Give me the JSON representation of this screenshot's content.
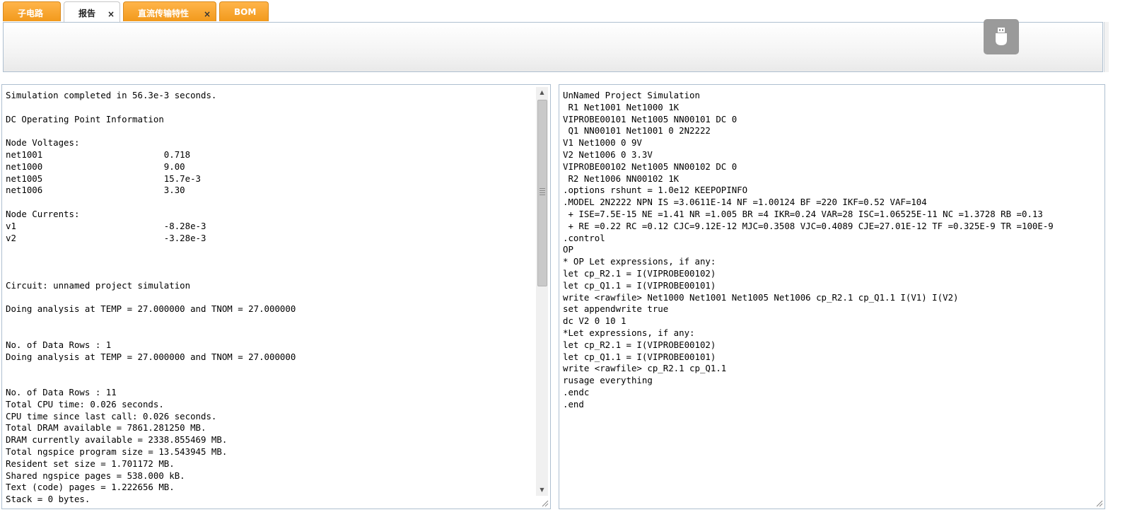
{
  "tabs": [
    {
      "label": "子电路",
      "closable": false,
      "active": false
    },
    {
      "label": "报告",
      "closable": true,
      "active": true
    },
    {
      "label": "直流传输特性",
      "closable": true,
      "active": false
    },
    {
      "label": "BOM",
      "closable": false,
      "active": false
    }
  ],
  "tab_close_glyph": "×",
  "toolbar": {
    "usb_icon": "usb-plug-icon"
  },
  "colors": {
    "tab_orange": "#f29a1c",
    "panel_border": "#aebfd0",
    "usb_button": "#9a9a9a"
  },
  "scrollbar": {
    "up_glyph": "▲",
    "down_glyph": "▼"
  },
  "report": {
    "lines": [
      "Simulation completed in 56.3e-3 seconds.",
      "",
      "DC Operating Point Information",
      "",
      "Node Voltages:",
      "net1001                       0.718",
      "net1000                       9.00",
      "net1005                       15.7e-3",
      "net1006                       3.30",
      "",
      "Node Currents:",
      "v1                            -8.28e-3",
      "v2                            -3.28e-3",
      "",
      "",
      "",
      "Circuit: unnamed project simulation",
      "",
      "Doing analysis at TEMP = 27.000000 and TNOM = 27.000000",
      "",
      "",
      "No. of Data Rows : 1",
      "Doing analysis at TEMP = 27.000000 and TNOM = 27.000000",
      "",
      "",
      "No. of Data Rows : 11",
      "Total CPU time: 0.026 seconds.",
      "CPU time since last call: 0.026 seconds.",
      "Total DRAM available = 7861.281250 MB.",
      "DRAM currently available = 2338.855469 MB.",
      "Total ngspice program size = 13.543945 MB.",
      "Resident set size = 1.701172 MB.",
      "Shared ngspice pages = 538.000 kB.",
      "Text (code) pages = 1.222656 MB.",
      "Stack = 0 bytes."
    ]
  },
  "netlist": {
    "lines": [
      "UnNamed Project Simulation",
      " R1 Net1001 Net1000 1K",
      "VIPROBE00101 Net1005 NN00101 DC 0",
      " Q1 NN00101 Net1001 0 2N2222",
      "V1 Net1000 0 9V",
      "V2 Net1006 0 3.3V",
      "VIPROBE00102 Net1005 NN00102 DC 0",
      " R2 Net1006 NN00102 1K",
      ".options rshunt = 1.0e12 KEEPOPINFO",
      ".MODEL 2N2222 NPN IS =3.0611E-14 NF =1.00124 BF =220 IKF=0.52 VAF=104",
      " + ISE=7.5E-15 NE =1.41 NR =1.005 BR =4 IKR=0.24 VAR=28 ISC=1.06525E-11 NC =1.3728 RB =0.13",
      " + RE =0.22 RC =0.12 CJC=9.12E-12 MJC=0.3508 VJC=0.4089 CJE=27.01E-12 TF =0.325E-9 TR =100E-9",
      ".control",
      "OP",
      "* OP Let expressions, if any:",
      "let cp_R2.1 = I(VIPROBE00102)",
      "let cp_Q1.1 = I(VIPROBE00101)",
      "write <rawfile> Net1000 Net1001 Net1005 Net1006 cp_R2.1 cp_Q1.1 I(V1) I(V2)",
      "set appendwrite true",
      "dc V2 0 10 1",
      "*Let expressions, if any:",
      "let cp_R2.1 = I(VIPROBE00102)",
      "let cp_Q1.1 = I(VIPROBE00101)",
      "write <rawfile> cp_R2.1 cp_Q1.1",
      "rusage everything",
      ".endc",
      ".end"
    ]
  }
}
